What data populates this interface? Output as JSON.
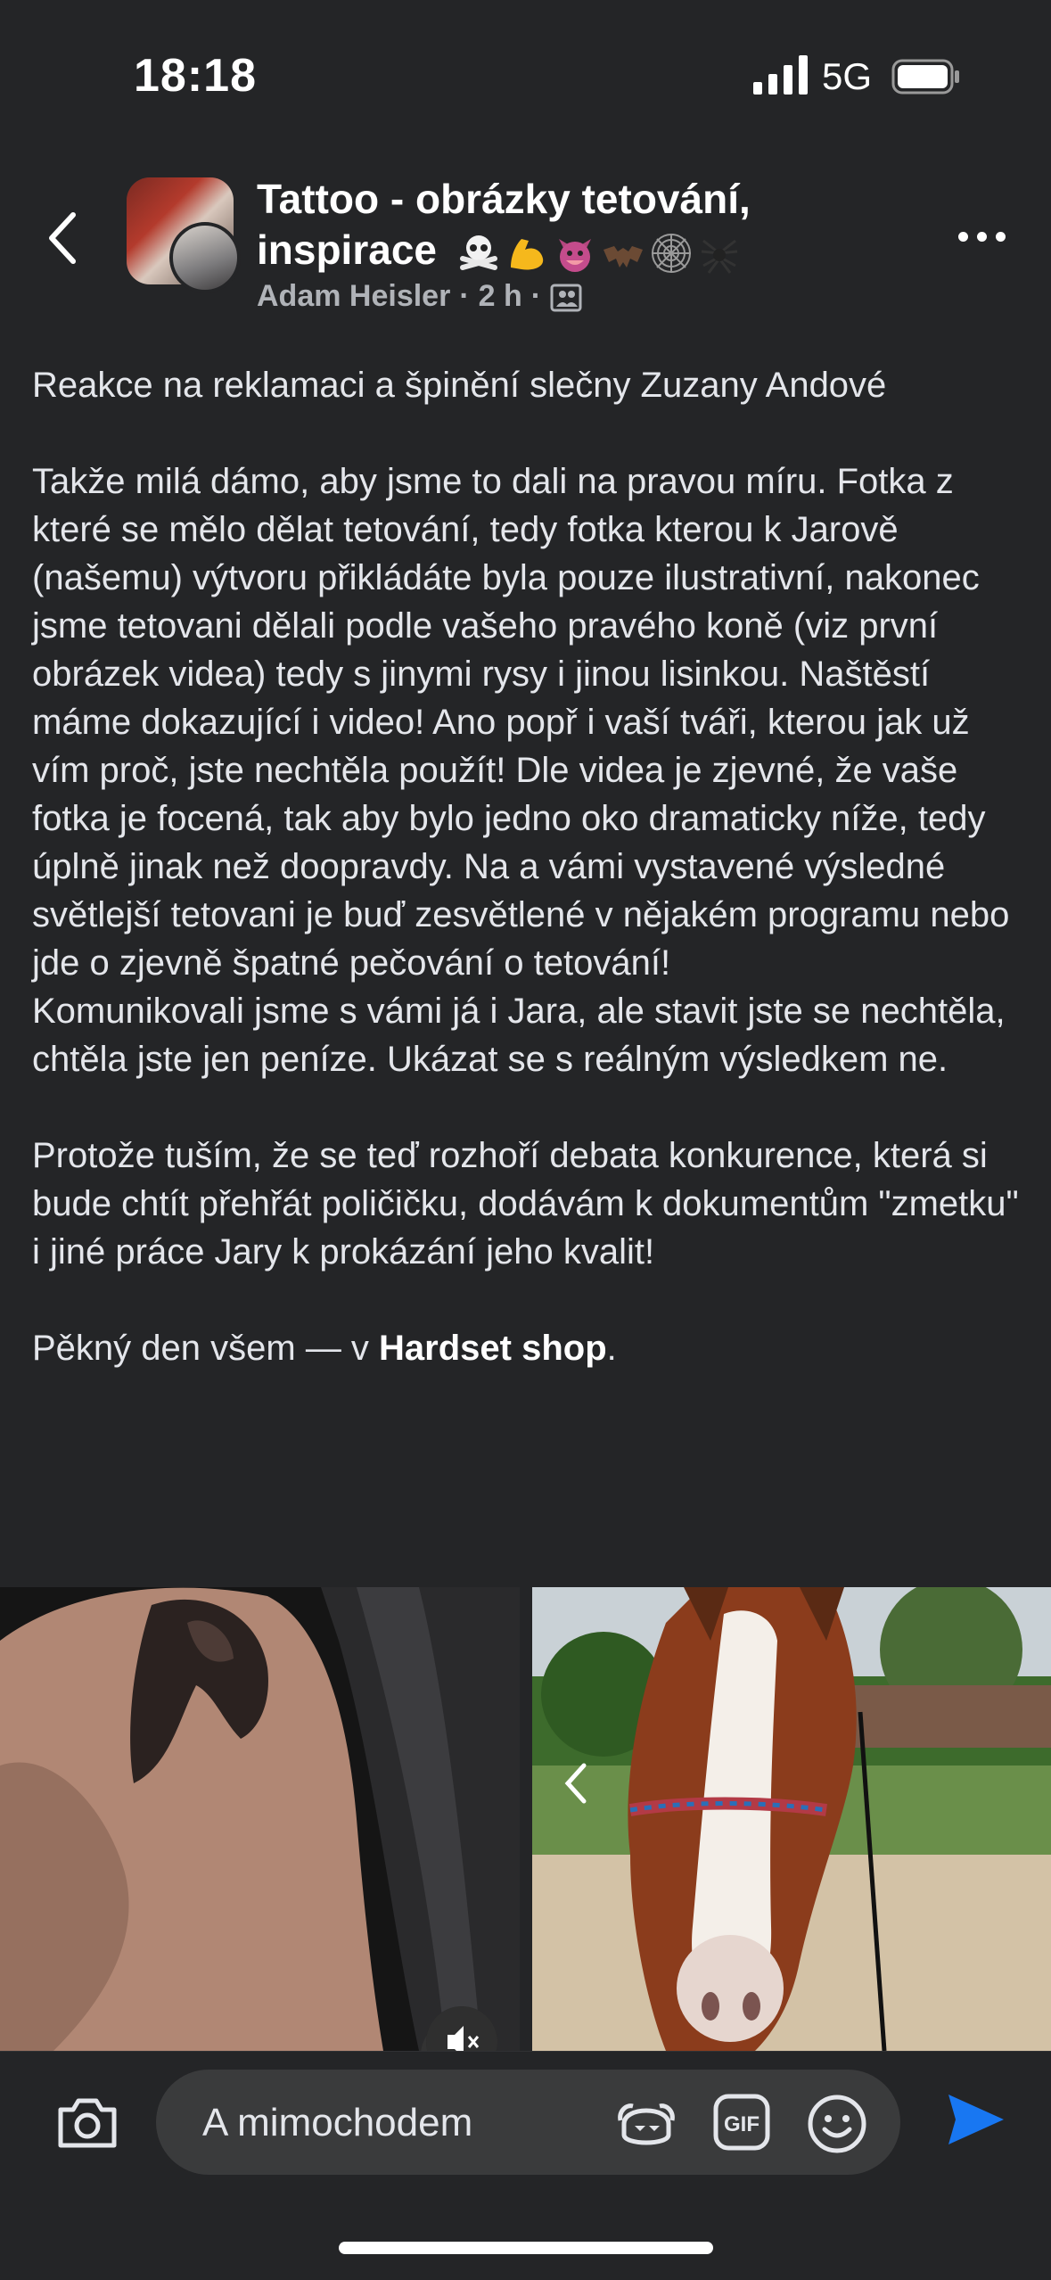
{
  "status_bar": {
    "time": "18:18",
    "network": "5G",
    "icons": [
      "signal-icon",
      "battery-icon"
    ]
  },
  "header": {
    "group_title_line1": "Tattoo - obrázky tetování,",
    "group_title_line2": "inspirace",
    "title_emojis": [
      "skull-crossbones-icon",
      "flexed-biceps-icon",
      "imp-face-icon",
      "bat-icon",
      "spider-web-icon",
      "spider-icon"
    ],
    "author": "Adam Heisler",
    "separator": "·",
    "time_ago": "2 h",
    "audience_icon": "group-audience-icon",
    "back_icon": "chevron-left-icon",
    "more_icon": "more-dots-icon"
  },
  "post": {
    "line_heading": "Reakce na reklamaci a špinění slečny Zuzany Andové",
    "paragraph1": "Takže milá dámo, aby jsme to dali na pravou míru. Fotka z které se mělo dělat tetování, tedy fotka kterou k Jarově (našemu) výtvoru přikládáte byla pouze ilustrativní, nakonec jsme tetovani dělali podle vašeho pravého koně (viz první obrázek videa) tedy s jinymi rysy i jinou lisinkou. Naštěstí máme dokazující i video! Ano popř i vaší tváři, kterou jak už vím proč, jste nechtěla použít! Dle videa je zjevné, že vaše fotka je focená, tak aby bylo jedno oko dramaticky níže, tedy úplně jinak než doopravdy. Na a vámi vystavené výsledné světlejší tetovani je buď zesvětlené v nějakém programu nebo jde o zjevně špatné pečování o tetování!",
    "paragraph2": "Komunikovali jsme s vámi já i Jara, ale stavit jste se nechtěla, chtěla jste jen peníze. Ukázat se s reálným výsledkem ne.",
    "paragraph3": "Protože tuším, že se teď rozhoří debata konkurence, která si bude chtít přehřát poličičku, dodávám k dokumentům \"zmetku\" i jiné práce Jary k prokázání jeho kvalit!",
    "closing_prefix": "Pěkný den všem — v ",
    "closing_bold": "Hardset shop",
    "closing_suffix": "."
  },
  "media": {
    "left_image": "tattoo-horse-arm-photo",
    "right_image": "horse-photo",
    "mute_icon": "muted-speaker-icon",
    "carousel_icon": "chevron-left-icon"
  },
  "composer": {
    "placeholder": "A mimochodem",
    "camera_icon": "camera-icon",
    "avatar_icon": "avatar-sticker-icon",
    "gif_label": "GIF",
    "emoji_icon": "smiley-icon",
    "send_icon": "send-icon",
    "accent": "#1877f2"
  }
}
